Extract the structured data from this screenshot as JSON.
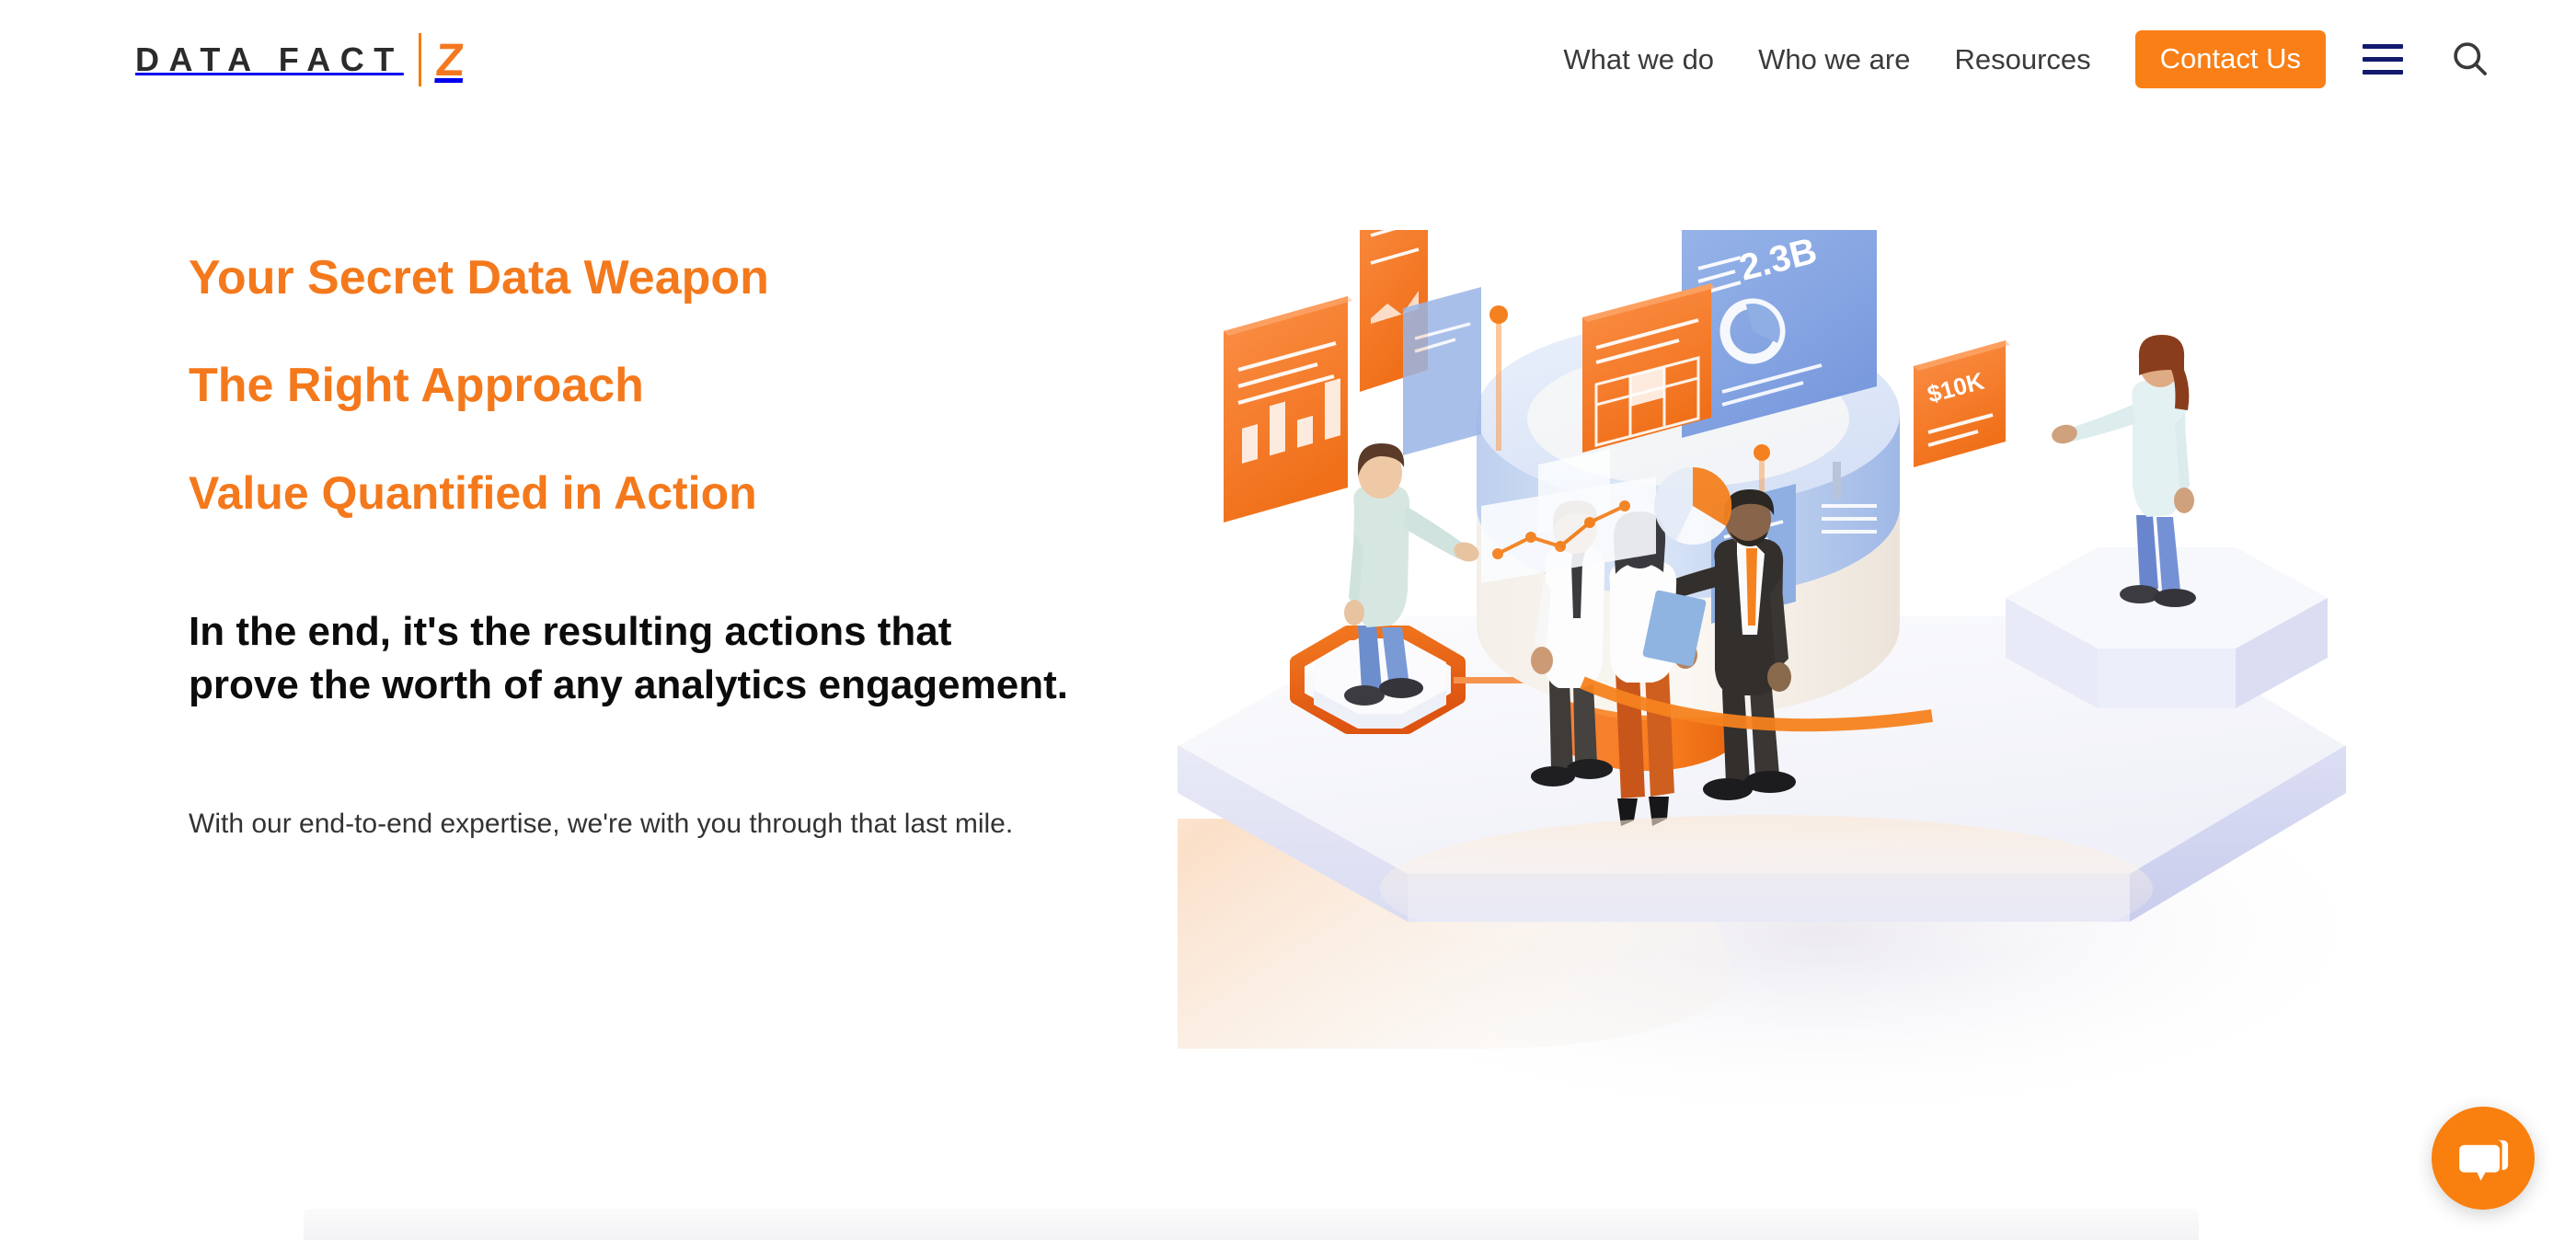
{
  "header": {
    "logo": {
      "wordmark": "DATA FACT",
      "mark": "Z",
      "divider_icon": "vertical-divider",
      "accent_color": "#f4781f"
    },
    "nav": [
      {
        "label": "What we do",
        "name": "nav-what-we-do"
      },
      {
        "label": "Who we are",
        "name": "nav-who-we-are"
      },
      {
        "label": "Resources",
        "name": "nav-resources"
      }
    ],
    "cta": {
      "label": "Contact Us",
      "bg_color": "#f97f16",
      "text_color": "#ffffff"
    },
    "menu_icon": "hamburger-menu-icon",
    "menu_icon_color": "#121a6e",
    "search_icon": "search-icon",
    "search_icon_color": "#3a3a3a"
  },
  "hero": {
    "headings": [
      "Your Secret Data Weapon",
      "The Right Approach",
      "Value Quantified in Action"
    ],
    "heading_color": "#f4791c",
    "lead": "In the end, it's the resulting actions that prove the worth of any analytics engagement.",
    "lead_color": "#0c0c0c",
    "subtext": "With our end-to-end expertise, we're with you through that last mile.",
    "subtext_color": "#333333"
  },
  "illustration": {
    "name": "isometric-data-analytics-illustration",
    "alt": "Isometric illustration of a data platform with floating dashboard cards and business people",
    "card_labels": {
      "metric_large": "2.3B",
      "metric_currency": "$10K"
    },
    "palette": {
      "orange": "#f5822a",
      "orange_deep": "#e8591d",
      "blue": "#7b9fdd",
      "blue_light": "#c3d4f0",
      "lavender": "#dcdef5",
      "platform_white": "#f6f7fb",
      "glow_peach": "#fbddc4"
    },
    "figures": [
      {
        "name": "man-mint-sweater",
        "top": "#d6e6e0",
        "bottom": "#6f8fcf"
      },
      {
        "name": "woman-ponytail-light-top",
        "top": "#e3f0f2",
        "bottom": "#6985cd"
      },
      {
        "name": "man-white-shirt-tie",
        "top": "#fdfdfd",
        "bottom": "#3e3b38"
      },
      {
        "name": "woman-rust-trousers-tablet",
        "top": "#fdfdfd",
        "bottom": "#c8561a"
      },
      {
        "name": "man-dark-suit-orange-tie",
        "top": "#332f2c",
        "bottom": "#332f2c"
      }
    ]
  },
  "chat": {
    "icon": "chat-bubble-icon",
    "bg_color": "#f97f0e",
    "icon_color": "#ffffff",
    "label": "Open chat"
  }
}
